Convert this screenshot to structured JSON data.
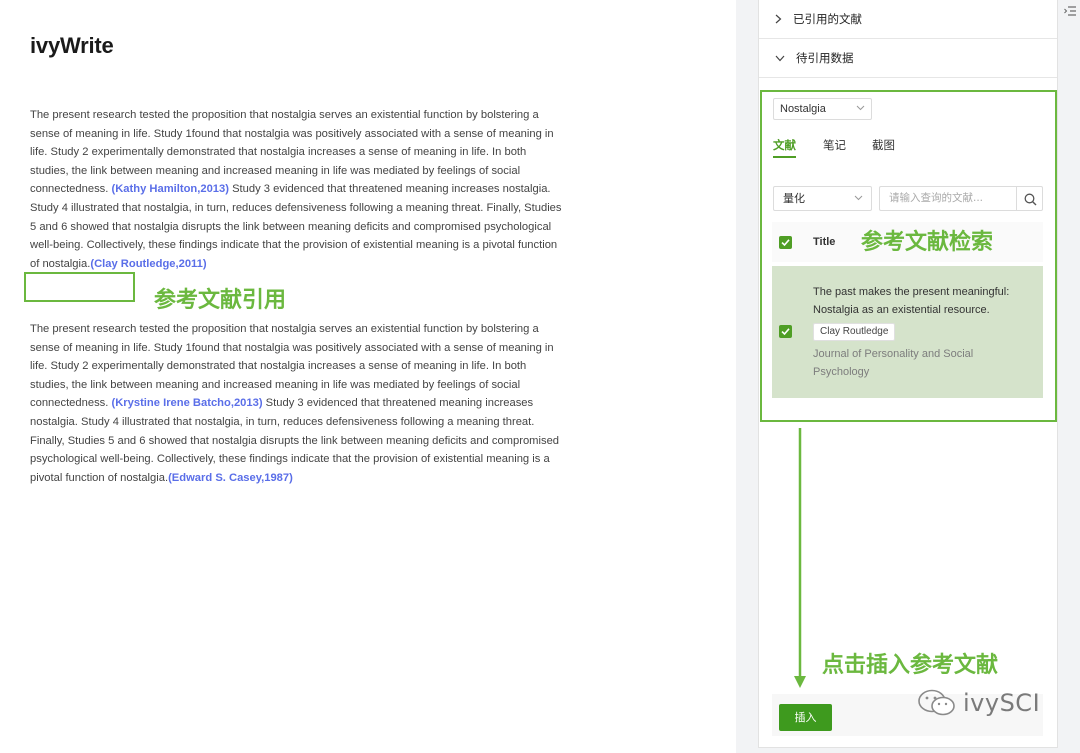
{
  "editor": {
    "title": "ivyWrite",
    "paragraphs": [
      {
        "text_a": "The present research tested the proposition that nostalgia serves an existential function by bolstering a sense of meaning in life. Study 1found that nostalgia was positively associated with a sense of meaning in life. Study 2 experimentally demonstrated that nostalgia increases a sense of meaning in life. In both studies, the link between meaning and increased meaning in life was mediated by feelings of social connectedness. ",
        "cite_a": "(Kathy Hamilton,2013)",
        "text_b": " Study 3 evidenced that threatened meaning increases nostalgia. Study 4 illustrated that nostalgia, in turn, reduces defensiveness following a meaning threat. Finally, Studies 5 and 6 showed that nostalgia disrupts the link between meaning deficits and compromised psychological well-being. Collectively, these findings indicate that the provision of existential meaning is a pivotal function of nostalgia.",
        "cite_b": "(Clay Routledge,2011)"
      },
      {
        "text_a": "The present research tested the proposition that nostalgia serves an existential function by bolstering a sense of meaning in life. Study 1found that nostalgia was positively associated with a sense of meaning in life. Study 2 experimentally demonstrated that nostalgia increases a sense of meaning in life. In both studies, the link between meaning and increased meaning in life was mediated by feelings of social connectedness. ",
        "cite_a": "(Krystine Irene Batcho,2013)",
        "text_b": " Study 3 evidenced that threatened meaning increases nostalgia. Study 4 illustrated that nostalgia, in turn, reduces defensiveness following a meaning threat. Finally, Studies 5 and 6 showed that nostalgia disrupts the link between meaning deficits and compromised psychological well-being. Collectively, these findings indicate that the provision of existential meaning is a pivotal function of nostalgia.",
        "cite_b": "(Edward S. Casey,1987)"
      }
    ]
  },
  "annotations": {
    "citation": "参考文献引用",
    "search": "参考文献检索",
    "insert": "点击插入参考文献"
  },
  "panel": {
    "cited_section": "已引用的文献",
    "pending_section": "待引用数据",
    "library_select": "Nostalgia",
    "tabs": [
      "文献",
      "笔记",
      "截图"
    ],
    "type_select": "量化",
    "search_placeholder": "请输入查询的文献...",
    "column_title": "Title",
    "result": {
      "title": "The past makes the present meaningful: Nostalgia as an existential resource.",
      "author": "Clay Routledge",
      "journal": "Journal of Personality and Social Psychology",
      "checked": true
    },
    "insert_button": "插入"
  },
  "watermark": "ivySCI",
  "colors": {
    "accent": "#4f9e25",
    "annotation": "#6bb83f",
    "citation": "#5a6ee8",
    "selected_row": "#d5e3cb"
  }
}
